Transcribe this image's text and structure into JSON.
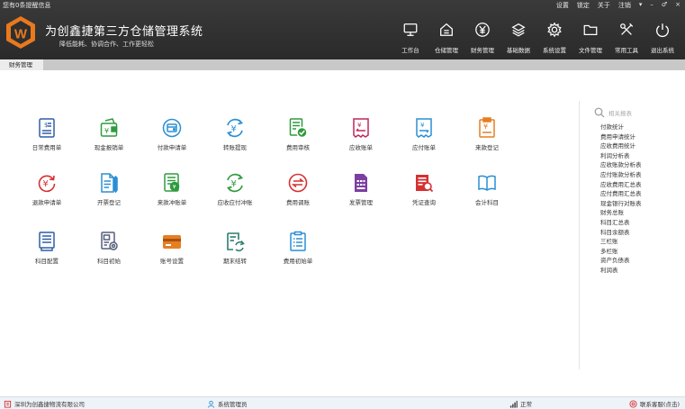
{
  "topbar": {
    "notice": "您有0条提醒信息",
    "links": [
      "设置",
      "锁定",
      "关于",
      "注销",
      "▾",
      "–",
      "♂",
      "×"
    ]
  },
  "app": {
    "logo_letter": "W",
    "title": "为创鑫捷第三方仓储管理系统",
    "slogan": "降低能耗、协调合作、工作更轻松"
  },
  "nav": [
    {
      "label": "工作台",
      "icon": "monitor-icon"
    },
    {
      "label": "仓储管理",
      "icon": "home-icon"
    },
    {
      "label": "财务管理",
      "icon": "yen-icon"
    },
    {
      "label": "基础数据",
      "icon": "layers-icon"
    },
    {
      "label": "系统设置",
      "icon": "gear-icon"
    },
    {
      "label": "文件管理",
      "icon": "folder-icon"
    },
    {
      "label": "常用工具",
      "icon": "tools-icon"
    },
    {
      "label": "退出系统",
      "icon": "power-icon"
    }
  ],
  "tabs": [
    {
      "label": "财务管理"
    }
  ],
  "functions": [
    {
      "label": "日常费用单",
      "icon": "expense-doc-icon",
      "color": "#2f5fa5"
    },
    {
      "label": "现金报销单",
      "icon": "wallet-yen-icon",
      "color": "#2e9b3e"
    },
    {
      "label": "付款申请单",
      "icon": "payment-wallet-icon",
      "color": "#2a8fd4"
    },
    {
      "label": "转账提现",
      "icon": "transfer-yen-icon",
      "color": "#2a8fd4"
    },
    {
      "label": "费用审核",
      "icon": "audit-check-icon",
      "color": "#2e9b3e"
    },
    {
      "label": "应收账单",
      "icon": "receivable-doc-icon",
      "color": "#c0265c"
    },
    {
      "label": "应付账单",
      "icon": "payable-doc-icon",
      "color": "#2a8fd4"
    },
    {
      "label": "来款登记",
      "icon": "income-doc-icon",
      "color": "#e67e22"
    },
    {
      "label": "退款申请单",
      "icon": "refund-yen-icon",
      "color": "#d63031"
    },
    {
      "label": "开票登记",
      "icon": "invoice-pen-icon",
      "color": "#2a8fd4"
    },
    {
      "label": "来款冲账单",
      "icon": "offset-doc-icon",
      "color": "#2e9b3e"
    },
    {
      "label": "应收应付冲账",
      "icon": "offset-yen-icon",
      "color": "#2e9b3e"
    },
    {
      "label": "费用调账",
      "icon": "adjust-arrows-icon",
      "color": "#d63031"
    },
    {
      "label": "发票管理",
      "icon": "invoice-grid-icon",
      "color": "#7b3fa0"
    },
    {
      "label": "凭证查询",
      "icon": "voucher-search-icon",
      "color": "#d63031"
    },
    {
      "label": "会计科目",
      "icon": "book-icon",
      "color": "#2a8fd4"
    },
    {
      "label": "科目配置",
      "icon": "subject-config-icon",
      "color": "#2f5fa5"
    },
    {
      "label": "科目初始",
      "icon": "subject-init-icon",
      "color": "#555f7a"
    },
    {
      "label": "账号设置",
      "icon": "bank-card-icon",
      "color": "#e67e22"
    },
    {
      "label": "期末结转",
      "icon": "period-close-icon",
      "color": "#2e7d6e"
    },
    {
      "label": "费用初始单",
      "icon": "expense-init-icon",
      "color": "#2a8fd4"
    }
  ],
  "side": {
    "search_placeholder": "相关报表",
    "reports": [
      "付款统计",
      "费用申请统计",
      "应收费用统计",
      "利润分析表",
      "应收账款分析表",
      "应付账款分析表",
      "应收费用汇总表",
      "应付费用汇总表",
      "现金银行对账表",
      "财务总账",
      "科目汇总表",
      "科目余额表",
      "三栏账",
      "多栏账",
      "资产负债表",
      "利润表"
    ]
  },
  "status": {
    "company": "深圳为创鑫捷物流有限公司",
    "user": "系统管理员",
    "connection": "正常",
    "backup": "联系客服(点击)"
  },
  "colors": {
    "header_bg": "#2f2f2f",
    "tab_strip": "#c8c8c8",
    "accent_blue": "#2a8fd4",
    "logo_orange": "#e8791e"
  }
}
